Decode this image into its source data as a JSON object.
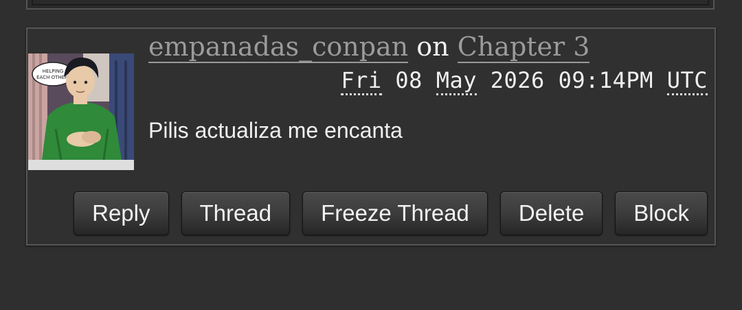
{
  "comment": {
    "author": "empanadas_conpan",
    "on_text": "on",
    "work_link": "Chapter 3",
    "date": {
      "day_abbr": "Fri",
      "day": "08",
      "month_abbr": "May",
      "year": "2026",
      "time": "09:14PM",
      "tz": "UTC"
    },
    "text": "Pilis actualiza me encanta",
    "avatar_speech": "HELPING EACH OTHER."
  },
  "actions": {
    "reply": "Reply",
    "thread": "Thread",
    "freeze_thread": "Freeze Thread",
    "delete": "Delete",
    "block": "Block"
  },
  "avatar_colors": {
    "shirt": "#2f8a3a",
    "hair": "#1a1a22",
    "skin": "#e8c9a8",
    "window": "#3a4a78",
    "curtain": "#caa3a0"
  }
}
